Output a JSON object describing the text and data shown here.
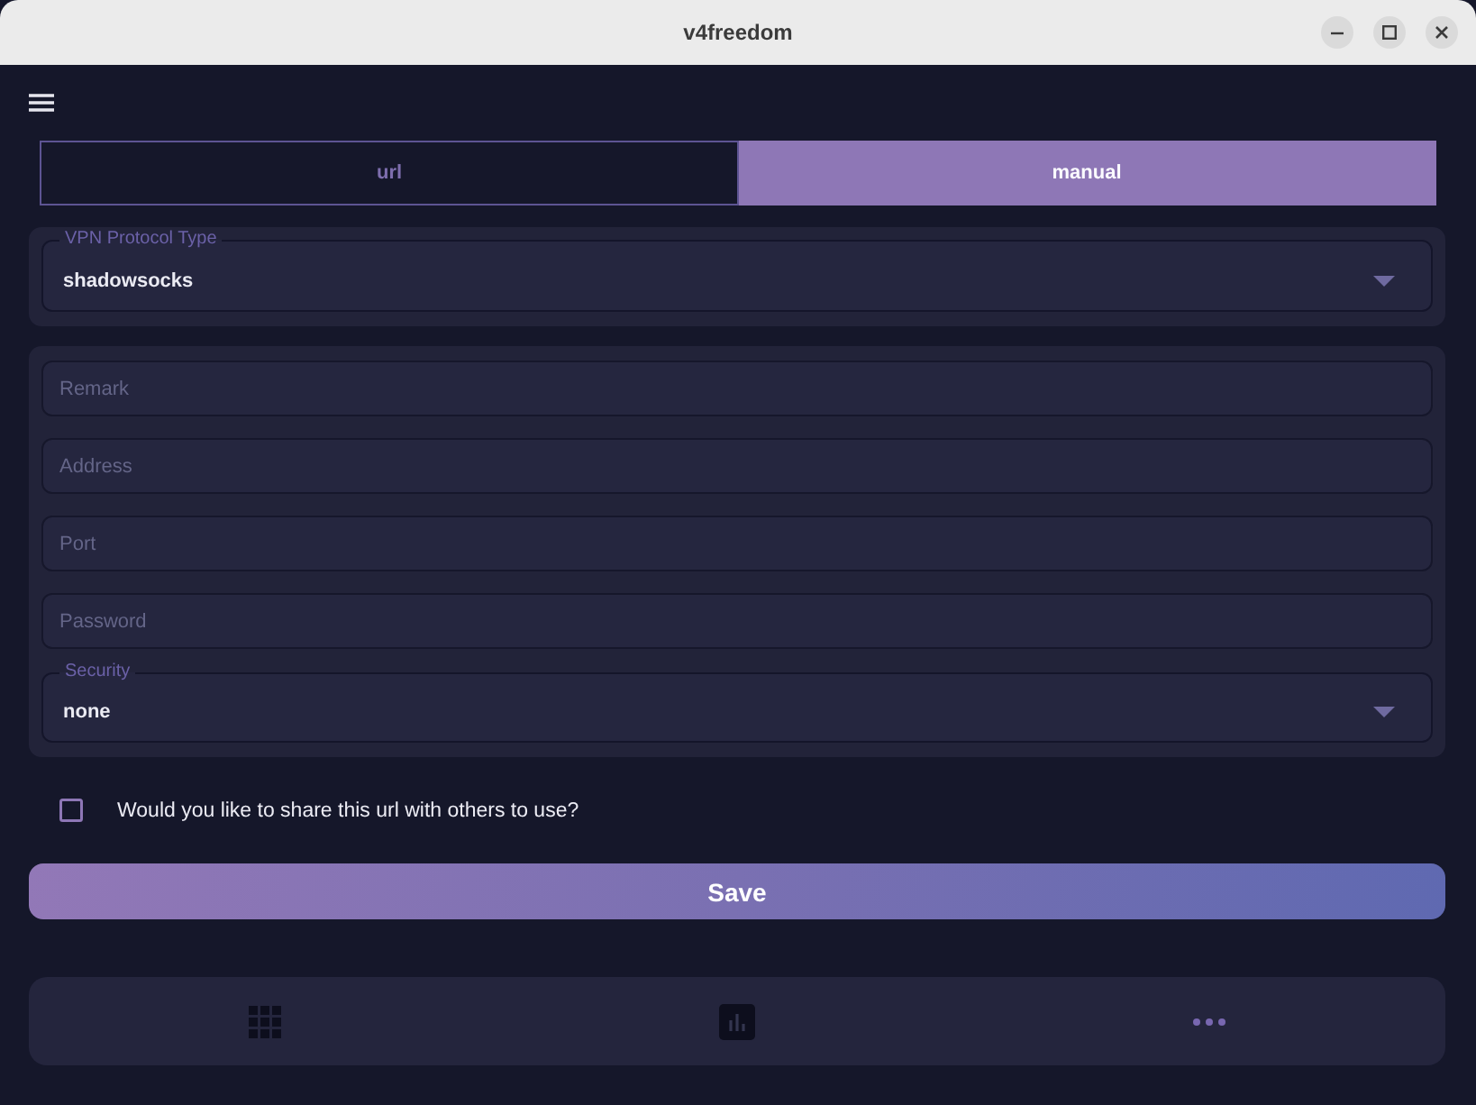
{
  "window": {
    "title": "v4freedom"
  },
  "tabs": [
    {
      "label": "url",
      "selected": false
    },
    {
      "label": "manual",
      "selected": true
    }
  ],
  "protocol": {
    "label": "VPN Protocol Type",
    "value": "shadowsocks"
  },
  "fields": [
    {
      "kind": "text",
      "placeholder": "Remark"
    },
    {
      "kind": "text",
      "placeholder": "Address"
    },
    {
      "kind": "text",
      "placeholder": "Port"
    },
    {
      "kind": "text",
      "placeholder": "Password"
    },
    {
      "kind": "select",
      "label": "Security",
      "value": "none"
    }
  ],
  "share_checkbox": {
    "label": "Would you like to share this url with others to use?",
    "checked": false
  },
  "save_button": {
    "label": "Save"
  },
  "bottom_nav": [
    {
      "kind": "grid"
    },
    {
      "kind": "chart"
    },
    {
      "kind": "more"
    }
  ]
}
